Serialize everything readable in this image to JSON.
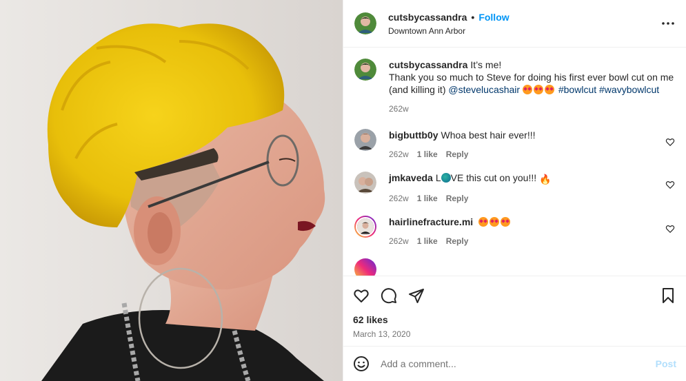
{
  "media": {
    "alt": ""
  },
  "header": {
    "username": "cutsbycassandra",
    "separator": "•",
    "follow_label": "Follow",
    "location": "Downtown Ann Arbor",
    "more_icon": "more-horizontal-icon"
  },
  "caption": {
    "username": "cutsbycassandra",
    "text_1": "It’s me!",
    "text_2": "Thank you so much to Steve for doing his first ever bowl cut on me (and killing it)",
    "mention": "@stevelucashair",
    "hashtag_1": "#bowlcut",
    "hashtag_2": "#wavybowlcut",
    "time": "262w"
  },
  "comments": [
    {
      "username": "bigbuttb0y",
      "text": "Whoa best hair ever!!!",
      "time": "262w",
      "likes": "1 like",
      "reply": "Reply"
    },
    {
      "username": "jmkaveda",
      "text_pre": "L",
      "text_post": "VE this cut on you!!!",
      "time": "262w",
      "likes": "1 like",
      "reply": "Reply"
    },
    {
      "username": "hairlinefracture.mi",
      "time": "262w",
      "likes": "1 like",
      "reply": "Reply"
    }
  ],
  "actions": {
    "like_icon": "heart-icon",
    "comment_icon": "comment-icon",
    "share_icon": "share-icon",
    "save_icon": "bookmark-icon"
  },
  "likes_text": "62 likes",
  "date_text": "March 13, 2020",
  "add_comment": {
    "placeholder": "Add a comment...",
    "post_label": "Post",
    "emoji_icon": "emoji-icon"
  },
  "colors": {
    "accent": "#0095f6",
    "link": "#00376b",
    "muted": "#737373",
    "post_disabled": "#b2dffc"
  }
}
